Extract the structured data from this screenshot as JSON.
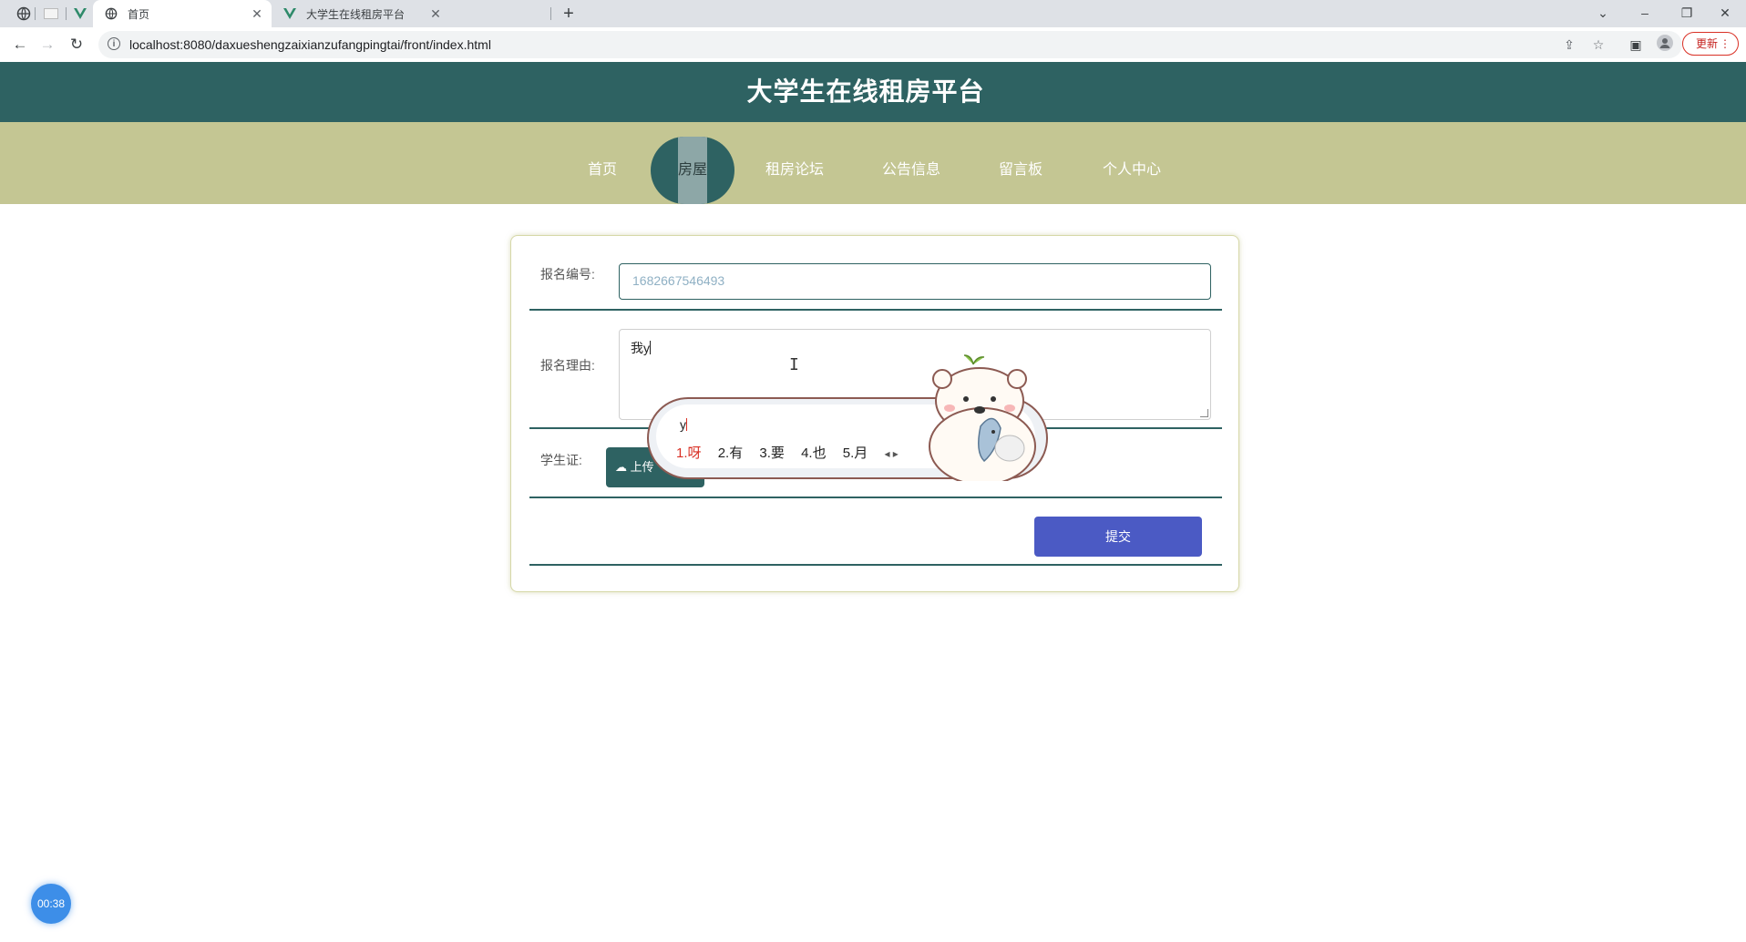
{
  "browser": {
    "tabs": [
      {
        "title": "首页",
        "active": true
      },
      {
        "title": "大学生在线租房平台",
        "active": false
      }
    ],
    "url": "localhost:8080/daxueshengzaixianzufangpingtai/front/index.html",
    "update_label": "更新"
  },
  "site": {
    "title": "大学生在线租房平台",
    "nav": [
      "首页",
      "房屋",
      "租房论坛",
      "公告信息",
      "留言板",
      "个人中心"
    ],
    "active_nav": "房屋"
  },
  "form": {
    "id_label": "报名编号:",
    "id_value": "1682667546493",
    "reason_label": "报名理由:",
    "reason_value": "我y",
    "student_card_label": "学生证:",
    "upload_label": "上传",
    "submit_label": "提交"
  },
  "ime": {
    "composition": "y",
    "candidates": [
      "1.呀",
      "2.有",
      "3.要",
      "4.也",
      "5.月"
    ],
    "selected_index": 0
  },
  "timer": {
    "label": "00:38"
  },
  "colors": {
    "header": "#2e6262",
    "nav_bar": "#c4c693",
    "submit": "#4b5ac4",
    "timer": "#3d8ee8"
  }
}
